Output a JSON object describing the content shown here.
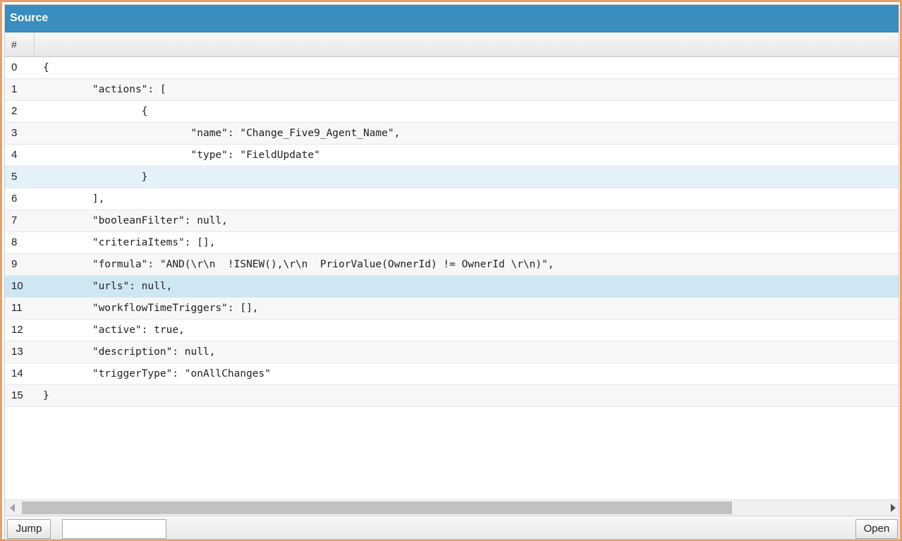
{
  "window": {
    "title": "Source"
  },
  "grid": {
    "column_header": "#",
    "rows": [
      {
        "num": "0",
        "code": "{"
      },
      {
        "num": "1",
        "code": "        \"actions\": ["
      },
      {
        "num": "2",
        "code": "                {"
      },
      {
        "num": "3",
        "code": "                        \"name\": \"Change_Five9_Agent_Name\","
      },
      {
        "num": "4",
        "code": "                        \"type\": \"FieldUpdate\""
      },
      {
        "num": "5",
        "code": "                }"
      },
      {
        "num": "6",
        "code": "        ],"
      },
      {
        "num": "7",
        "code": "        \"booleanFilter\": null,"
      },
      {
        "num": "8",
        "code": "        \"criteriaItems\": [],"
      },
      {
        "num": "9",
        "code": "        \"formula\": \"AND(\\r\\n  !ISNEW(),\\r\\n  PriorValue(OwnerId) != OwnerId \\r\\n)\","
      },
      {
        "num": "10",
        "code": "        \"urls\": null,"
      },
      {
        "num": "11",
        "code": "        \"workflowTimeTriggers\": [],"
      },
      {
        "num": "12",
        "code": "        \"active\": true,"
      },
      {
        "num": "13",
        "code": "        \"description\": null,"
      },
      {
        "num": "14",
        "code": "        \"triggerType\": \"onAllChanges\""
      },
      {
        "num": "15",
        "code": "}"
      }
    ]
  },
  "footer": {
    "jump_label": "Jump",
    "jump_input_value": "",
    "open_label": "Open"
  },
  "colors": {
    "titlebar": "#3a8dbf",
    "frame_border": "#e8a068",
    "hover_row": "#e3f1fb",
    "selected_row": "#cfe7f3"
  }
}
